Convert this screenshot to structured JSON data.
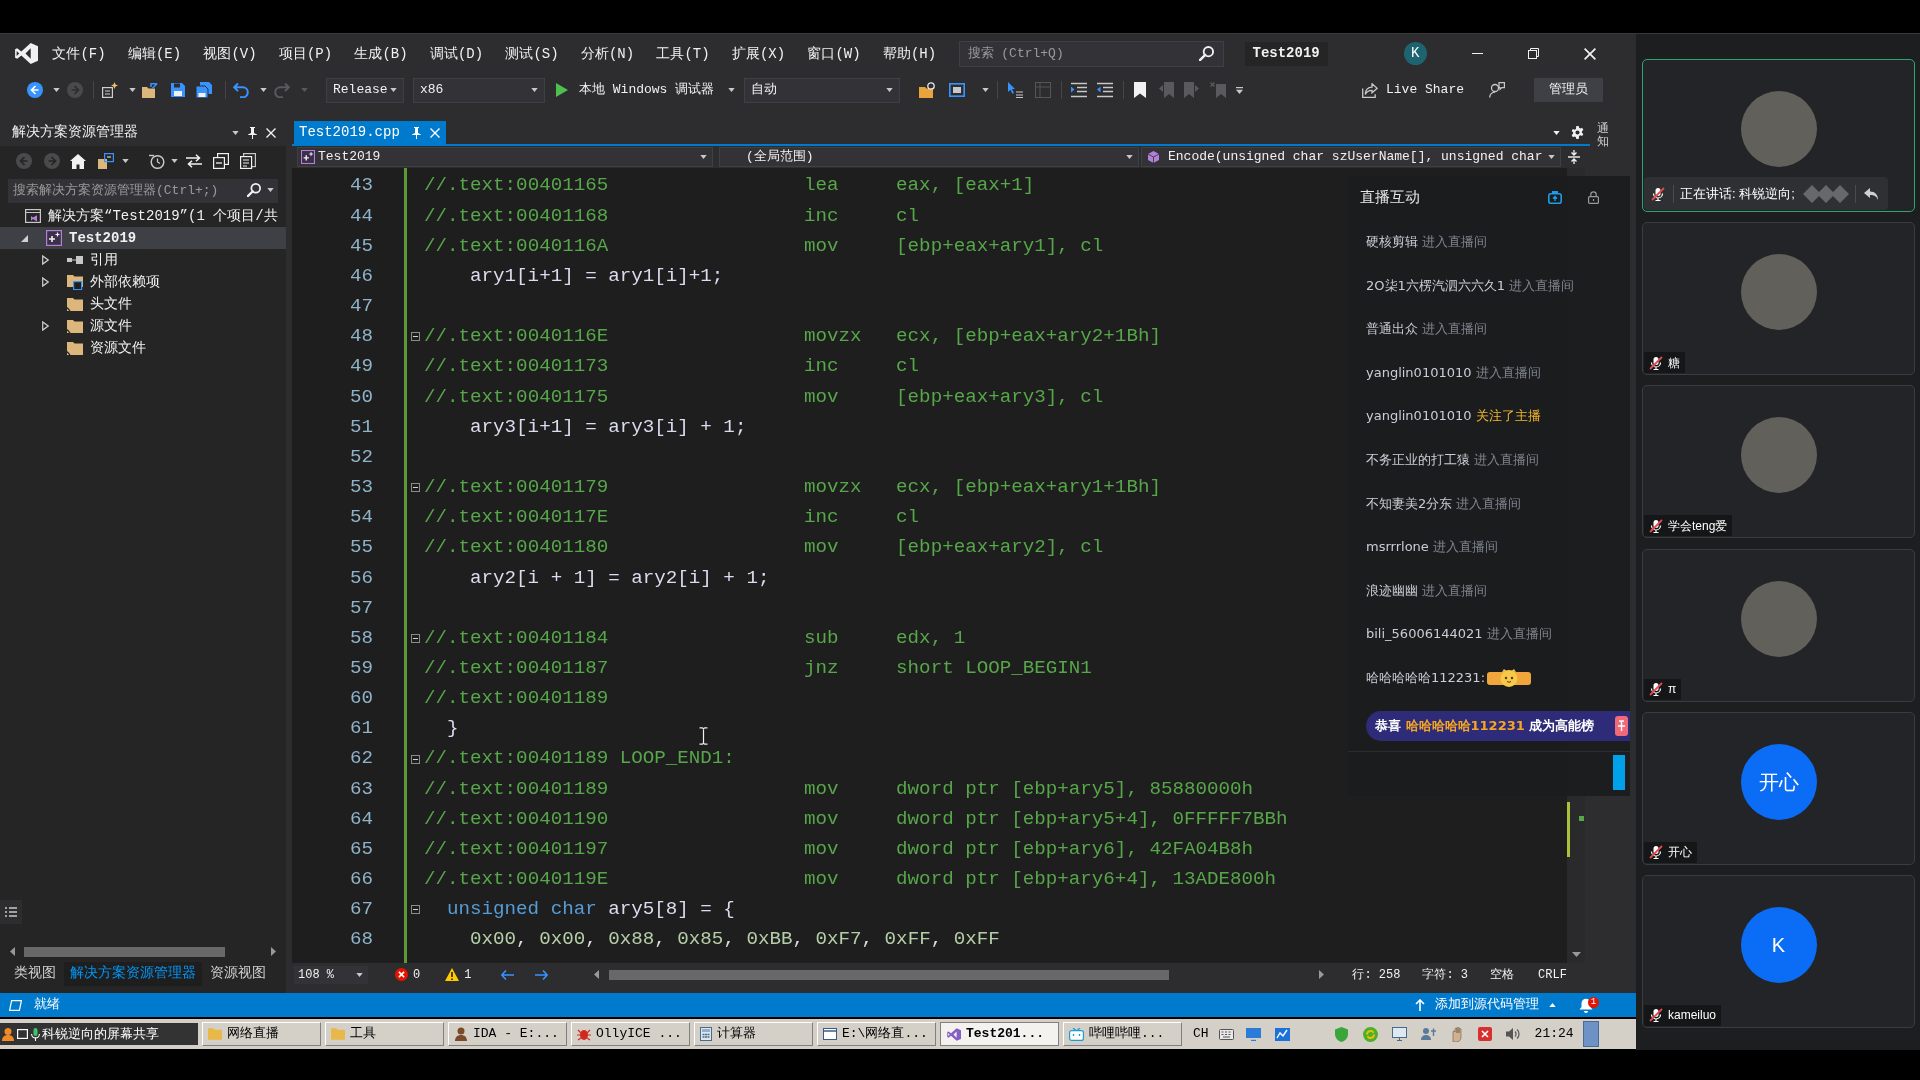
{
  "title_bar": {
    "menu": [
      "文件(F)",
      "编辑(E)",
      "视图(V)",
      "项目(P)",
      "生成(B)",
      "调试(D)",
      "测试(S)",
      "分析(N)",
      "工具(T)",
      "扩展(X)",
      "窗口(W)",
      "帮助(H)"
    ],
    "search": {
      "placeholder": "搜索 (Ctrl+Q)"
    },
    "solution_title": "Test2019",
    "account_initial": "K"
  },
  "toolbar": {
    "configuration": "Release",
    "platform": "x86",
    "debugger": "本地 Windows 调试器",
    "target": "自动",
    "live_share": "Live Share",
    "admin": "管理员"
  },
  "solution_explorer": {
    "title": "解决方案资源管理器",
    "search": {
      "placeholder": "搜索解决方案资源管理器(Ctrl+;)"
    },
    "tree": [
      {
        "label": "解决方案“Test2019”(1 个项目/共",
        "kind": "solution",
        "expandable": false,
        "selected": false,
        "children": [
          {
            "label": "Test2019",
            "kind": "project",
            "expandable": true,
            "expanded": true,
            "selected": true,
            "children": [
              {
                "label": "引用",
                "kind": "references",
                "expandable": true,
                "expanded": false,
                "selected": false
              },
              {
                "label": "外部依赖项",
                "kind": "external",
                "expandable": true,
                "expanded": false,
                "selected": false
              },
              {
                "label": "头文件",
                "kind": "folder",
                "expandable": false,
                "selected": false
              },
              {
                "label": "源文件",
                "kind": "folder",
                "expandable": true,
                "expanded": false,
                "selected": false
              },
              {
                "label": "资源文件",
                "kind": "folder",
                "expandable": false,
                "selected": false
              }
            ]
          }
        ]
      }
    ],
    "tabs": [
      {
        "label": "类视图",
        "selected": false
      },
      {
        "label": "解决方案资源管理器",
        "selected": true
      },
      {
        "label": "资源视图",
        "selected": false
      }
    ]
  },
  "editor": {
    "tabs": [
      {
        "label": "Test2019.cpp",
        "selected": true
      }
    ],
    "navigation": {
      "project": "Test2019",
      "scope": "(全局范围)",
      "member": "Encode(unsigned char szUserName[], unsigned char"
    },
    "lines": [
      {
        "number": "43",
        "foldable": false,
        "segments": [
          {
            "kind": "comment",
            "text": "//.text:00401165                 lea     eax, [eax+1]"
          }
        ]
      },
      {
        "number": "44",
        "foldable": false,
        "segments": [
          {
            "kind": "comment",
            "text": "//.text:00401168                 inc     cl"
          }
        ]
      },
      {
        "number": "45",
        "foldable": false,
        "segments": [
          {
            "kind": "comment",
            "text": "//.text:0040116A                 mov     [ebp+eax+ary1], cl"
          }
        ]
      },
      {
        "number": "46",
        "foldable": false,
        "segments": [
          {
            "kind": "code",
            "text": "    ary1[i+1] = ary1[i]+1;"
          }
        ]
      },
      {
        "number": "47",
        "foldable": false
      },
      {
        "number": "48",
        "foldable": true,
        "segments": [
          {
            "kind": "comment",
            "text": "//.text:0040116E                 movzx   ecx, [ebp+eax+ary2+1Bh]"
          }
        ]
      },
      {
        "number": "49",
        "foldable": false,
        "segments": [
          {
            "kind": "comment",
            "text": "//.text:00401173                 inc     cl"
          }
        ]
      },
      {
        "number": "50",
        "foldable": false,
        "segments": [
          {
            "kind": "comment",
            "text": "//.text:00401175                 mov     [ebp+eax+ary3], cl"
          }
        ]
      },
      {
        "number": "51",
        "foldable": false,
        "segments": [
          {
            "kind": "code",
            "text": "    ary3[i+1] = ary3[i] + 1;"
          }
        ]
      },
      {
        "number": "52",
        "foldable": false
      },
      {
        "number": "53",
        "foldable": true,
        "segments": [
          {
            "kind": "comment",
            "text": "//.text:00401179                 movzx   ecx, [ebp+eax+ary1+1Bh]"
          }
        ]
      },
      {
        "number": "54",
        "foldable": false,
        "segments": [
          {
            "kind": "comment",
            "text": "//.text:0040117E                 inc     cl"
          }
        ]
      },
      {
        "number": "55",
        "foldable": false,
        "segments": [
          {
            "kind": "comment",
            "text": "//.text:00401180                 mov     [ebp+eax+ary2], cl"
          }
        ]
      },
      {
        "number": "56",
        "foldable": false,
        "segments": [
          {
            "kind": "code",
            "text": "    ary2[i + 1] = ary2[i] + 1;"
          }
        ]
      },
      {
        "number": "57",
        "foldable": false
      },
      {
        "number": "58",
        "foldable": true,
        "segments": [
          {
            "kind": "comment",
            "text": "//.text:00401184                 sub     edx, 1"
          }
        ]
      },
      {
        "number": "59",
        "foldable": false,
        "segments": [
          {
            "kind": "comment",
            "text": "//.text:00401187                 jnz     short LOOP_BEGIN1"
          }
        ]
      },
      {
        "number": "60",
        "foldable": false,
        "segments": [
          {
            "kind": "comment",
            "text": "//.text:00401189"
          }
        ]
      },
      {
        "number": "61",
        "foldable": false,
        "segments": [
          {
            "kind": "code",
            "text": "  }"
          }
        ]
      },
      {
        "number": "62",
        "foldable": true,
        "segments": [
          {
            "kind": "comment",
            "text": "//.text:00401189 LOOP_END1:"
          }
        ]
      },
      {
        "number": "63",
        "foldable": false,
        "segments": [
          {
            "kind": "comment",
            "text": "//.text:00401189                 mov     dword ptr [ebp+ary5], 85880000h"
          }
        ]
      },
      {
        "number": "64",
        "foldable": false,
        "segments": [
          {
            "kind": "comment",
            "text": "//.text:00401190                 mov     dword ptr [ebp+ary5+4], 0FFFFF7BBh"
          }
        ]
      },
      {
        "number": "65",
        "foldable": false,
        "segments": [
          {
            "kind": "comment",
            "text": "//.text:00401197                 mov     dword ptr [ebp+ary6], 42FA04B8h"
          }
        ]
      },
      {
        "number": "66",
        "foldable": false,
        "segments": [
          {
            "kind": "comment",
            "text": "//.text:0040119E                 mov     dword ptr [ebp+ary6+4], 13ADE800h"
          }
        ]
      },
      {
        "number": "67",
        "foldable": true,
        "segments": [
          {
            "kind": "keyword",
            "text": "  unsigned char"
          },
          {
            "kind": "code",
            "text": " ary5[8] = {"
          }
        ]
      },
      {
        "number": "68",
        "foldable": false,
        "segments": [
          {
            "kind": "number",
            "text": "    0x00"
          },
          {
            "kind": "plain",
            "text": ", "
          },
          {
            "kind": "number",
            "text": "0x00"
          },
          {
            "kind": "plain",
            "text": ", "
          },
          {
            "kind": "number",
            "text": "0x88"
          },
          {
            "kind": "plain",
            "text": ", "
          },
          {
            "kind": "number",
            "text": "0x85"
          },
          {
            "kind": "plain",
            "text": ", "
          },
          {
            "kind": "number",
            "text": "0xBB"
          },
          {
            "kind": "plain",
            "text": ", "
          },
          {
            "kind": "number",
            "text": "0xF7"
          },
          {
            "kind": "plain",
            "text": ", "
          },
          {
            "kind": "number",
            "text": "0xFF"
          },
          {
            "kind": "plain",
            "text": ", "
          },
          {
            "kind": "number",
            "text": "0xFF"
          }
        ]
      }
    ],
    "zoom": "108 %",
    "errors": "0",
    "warnings": "1",
    "line": "行: 258",
    "column": "字符: 3",
    "indentation": "空格",
    "line_endings": "CRLF"
  },
  "notifications_tab": "通知",
  "live_chat": {
    "title": "直播互动",
    "messages": [
      {
        "user": "硬核剪辑",
        "kind": "enter",
        "action": "进入直播间"
      },
      {
        "user": "2O柒1六楞汽泗六六久1",
        "kind": "enter",
        "action": "进入直播间"
      },
      {
        "user": "普通出众",
        "kind": "enter",
        "action": "进入直播间"
      },
      {
        "user": "yanglin0101010",
        "kind": "enter",
        "action": "进入直播间"
      },
      {
        "user": "yanglin0101010",
        "kind": "follow",
        "action": "关注了主播"
      },
      {
        "user": "不务正业的打工猿",
        "kind": "enter",
        "action": "进入直播间"
      },
      {
        "user": "不知妻美2分东",
        "kind": "enter",
        "action": "进入直播间"
      },
      {
        "user": "msrrrlone",
        "kind": "enter",
        "action": "进入直播间"
      },
      {
        "user": "浪迹幽幽",
        "kind": "enter",
        "action": "进入直播间"
      },
      {
        "user": "bili_56006144021",
        "kind": "enter",
        "action": "进入直播间"
      },
      {
        "user": "哈哈哈哈哈112231:",
        "kind": "sticker"
      }
    ],
    "notice": {
      "prefix": "恭喜",
      "user": "哈哈哈哈哈112231",
      "suffix": "成为高能榜"
    }
  },
  "status_bar": {
    "text": "就绪",
    "source_control": "添加到源代码管理",
    "notifications": "1"
  },
  "taskbar": {
    "share_tag": "科锐逆向的屏幕共享",
    "buttons": [
      {
        "label": "网络直播",
        "kind": "folder",
        "selected": false
      },
      {
        "label": "工具",
        "kind": "folder",
        "selected": false
      },
      {
        "label": "IDA - E:...",
        "kind": "ida",
        "selected": false
      },
      {
        "label": "OllyICE ...",
        "kind": "debugger",
        "selected": false
      },
      {
        "label": "计算器",
        "kind": "calculator",
        "selected": false
      },
      {
        "label": "E:\\网络直...",
        "kind": "explorer",
        "selected": false
      },
      {
        "label": "Test201...",
        "kind": "ide",
        "selected": true
      },
      {
        "label": "哔哩哔哩...",
        "kind": "browser",
        "selected": false
      }
    ],
    "language": "CH",
    "clock": "21:24"
  },
  "participants": [
    {
      "kind": "photo",
      "status": "正在讲话: 科锐逆向;",
      "speaking": true,
      "muted": true
    },
    {
      "kind": "photo",
      "name": "糖",
      "speaking": false,
      "muted": true
    },
    {
      "kind": "photo",
      "name": "学会teng爱",
      "speaking": false,
      "muted": true
    },
    {
      "kind": "photo",
      "name": "π",
      "speaking": false,
      "muted": true
    },
    {
      "kind": "initials",
      "initials": "开心",
      "name": "开心",
      "speaking": false,
      "muted": true
    },
    {
      "kind": "initials",
      "initials": "K",
      "name": "kameiluo",
      "speaking": false,
      "muted": true
    }
  ]
}
